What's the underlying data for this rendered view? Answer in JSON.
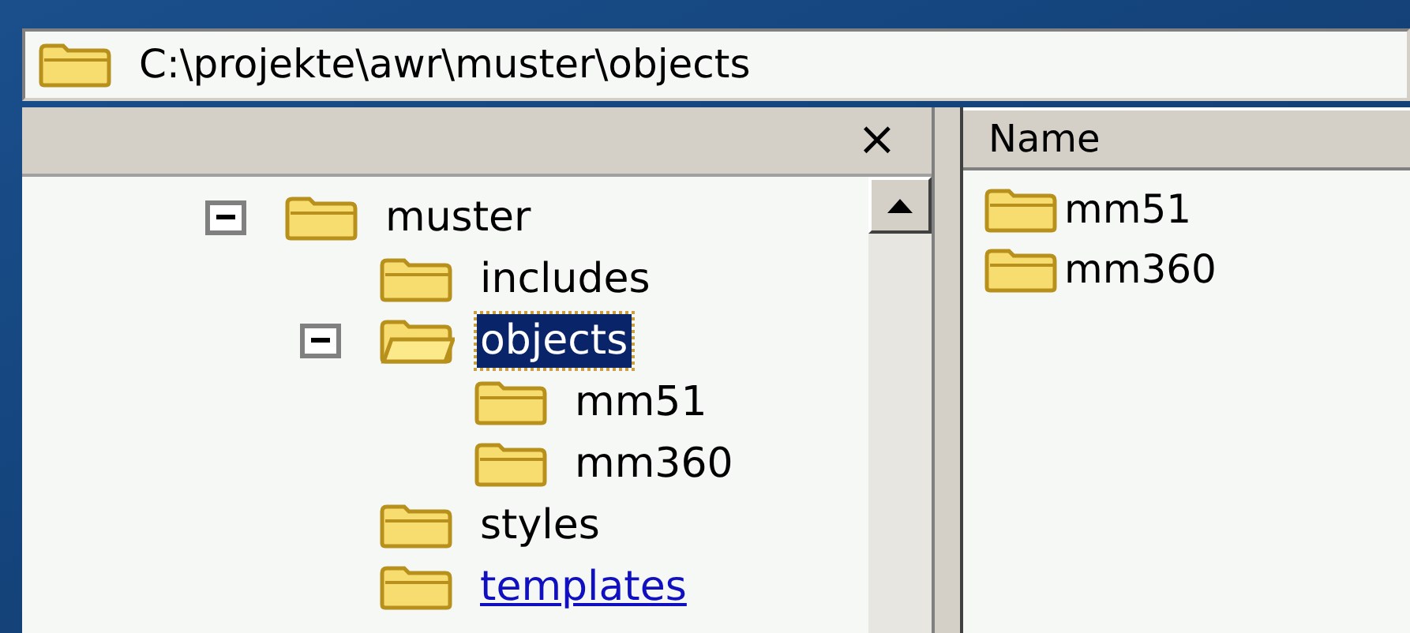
{
  "address_bar": {
    "path": "C:\\projekte\\awr\\muster\\objects"
  },
  "folder_pane": {
    "close": "×",
    "tree": [
      {
        "label": "muster",
        "selected": false,
        "hovered": false,
        "expanded": true,
        "children": [
          {
            "label": "includes",
            "selected": false,
            "hovered": false
          },
          {
            "label": "objects",
            "selected": true,
            "hovered": false,
            "expanded": true,
            "children": [
              {
                "label": "mm51",
                "selected": false,
                "hovered": false
              },
              {
                "label": "mm360",
                "selected": false,
                "hovered": false
              }
            ]
          },
          {
            "label": "styles",
            "selected": false,
            "hovered": false
          },
          {
            "label": "templates",
            "selected": false,
            "hovered": true
          }
        ]
      }
    ]
  },
  "file_list": {
    "columns": [
      "Name"
    ],
    "items": [
      {
        "name": "mm51"
      },
      {
        "name": "mm360"
      }
    ]
  }
}
